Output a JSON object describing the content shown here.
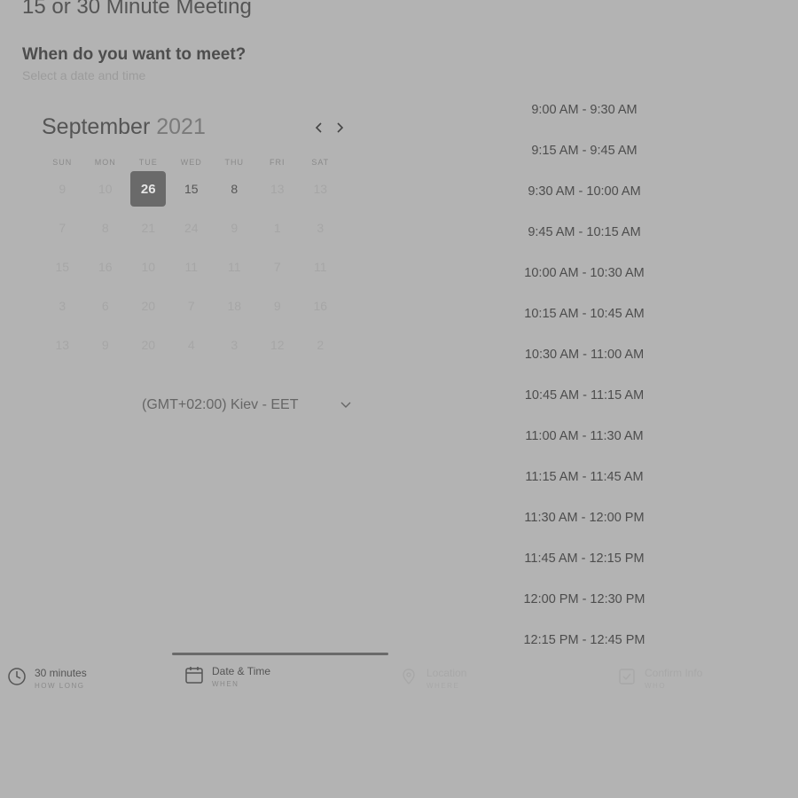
{
  "page": {
    "title": "15 or 30 Minute Meeting",
    "section_title": "When do you want to meet?",
    "section_subtitle": "Select a date and time"
  },
  "calendar": {
    "month": "September",
    "year": "2021",
    "weekdays": [
      "SUN",
      "MON",
      "TUE",
      "WED",
      "THU",
      "FRI",
      "SAT"
    ],
    "weeks": [
      [
        {
          "d": "9"
        },
        {
          "d": "10"
        },
        {
          "d": "26",
          "state": "selected"
        },
        {
          "d": "15",
          "state": "available"
        },
        {
          "d": "8",
          "state": "available"
        },
        {
          "d": "13"
        },
        {
          "d": "13"
        }
      ],
      [
        {
          "d": "7"
        },
        {
          "d": "8"
        },
        {
          "d": "21"
        },
        {
          "d": "24"
        },
        {
          "d": "9"
        },
        {
          "d": "1"
        },
        {
          "d": "3"
        }
      ],
      [
        {
          "d": "15"
        },
        {
          "d": "16"
        },
        {
          "d": "10"
        },
        {
          "d": "11"
        },
        {
          "d": "11"
        },
        {
          "d": "7"
        },
        {
          "d": "11"
        }
      ],
      [
        {
          "d": "3"
        },
        {
          "d": "6"
        },
        {
          "d": "20"
        },
        {
          "d": "7"
        },
        {
          "d": "18"
        },
        {
          "d": "9"
        },
        {
          "d": "16"
        }
      ],
      [
        {
          "d": "13"
        },
        {
          "d": "9"
        },
        {
          "d": "20"
        },
        {
          "d": "4"
        },
        {
          "d": "3"
        },
        {
          "d": "12"
        },
        {
          "d": "2"
        }
      ]
    ]
  },
  "timezone": {
    "label": "(GMT+02:00) Kiev - EET"
  },
  "time_slots": [
    "9:00 AM - 9:30 AM",
    "9:15 AM - 9:45 AM",
    "9:30 AM - 10:00 AM",
    "9:45 AM - 10:15 AM",
    "10:00 AM - 10:30 AM",
    "10:15 AM - 10:45 AM",
    "10:30 AM - 11:00 AM",
    "10:45 AM - 11:15 AM",
    "11:00 AM - 11:30 AM",
    "11:15 AM - 11:45 AM",
    "11:30 AM - 12:00 PM",
    "11:45 AM - 12:15 PM",
    "12:00 PM - 12:30 PM",
    "12:15 PM - 12:45 PM"
  ],
  "steps": {
    "duration": {
      "label": "30 minutes",
      "sub": "HOW LONG",
      "icon": "clock-icon"
    },
    "datetime": {
      "label": "Date & Time",
      "sub": "WHEN",
      "icon": "calendar-icon"
    },
    "location": {
      "label": "Location",
      "sub": "WHERE",
      "icon": "location-icon"
    },
    "confirm": {
      "label": "Confirm Info",
      "sub": "WHO",
      "icon": "confirm-icon"
    }
  }
}
